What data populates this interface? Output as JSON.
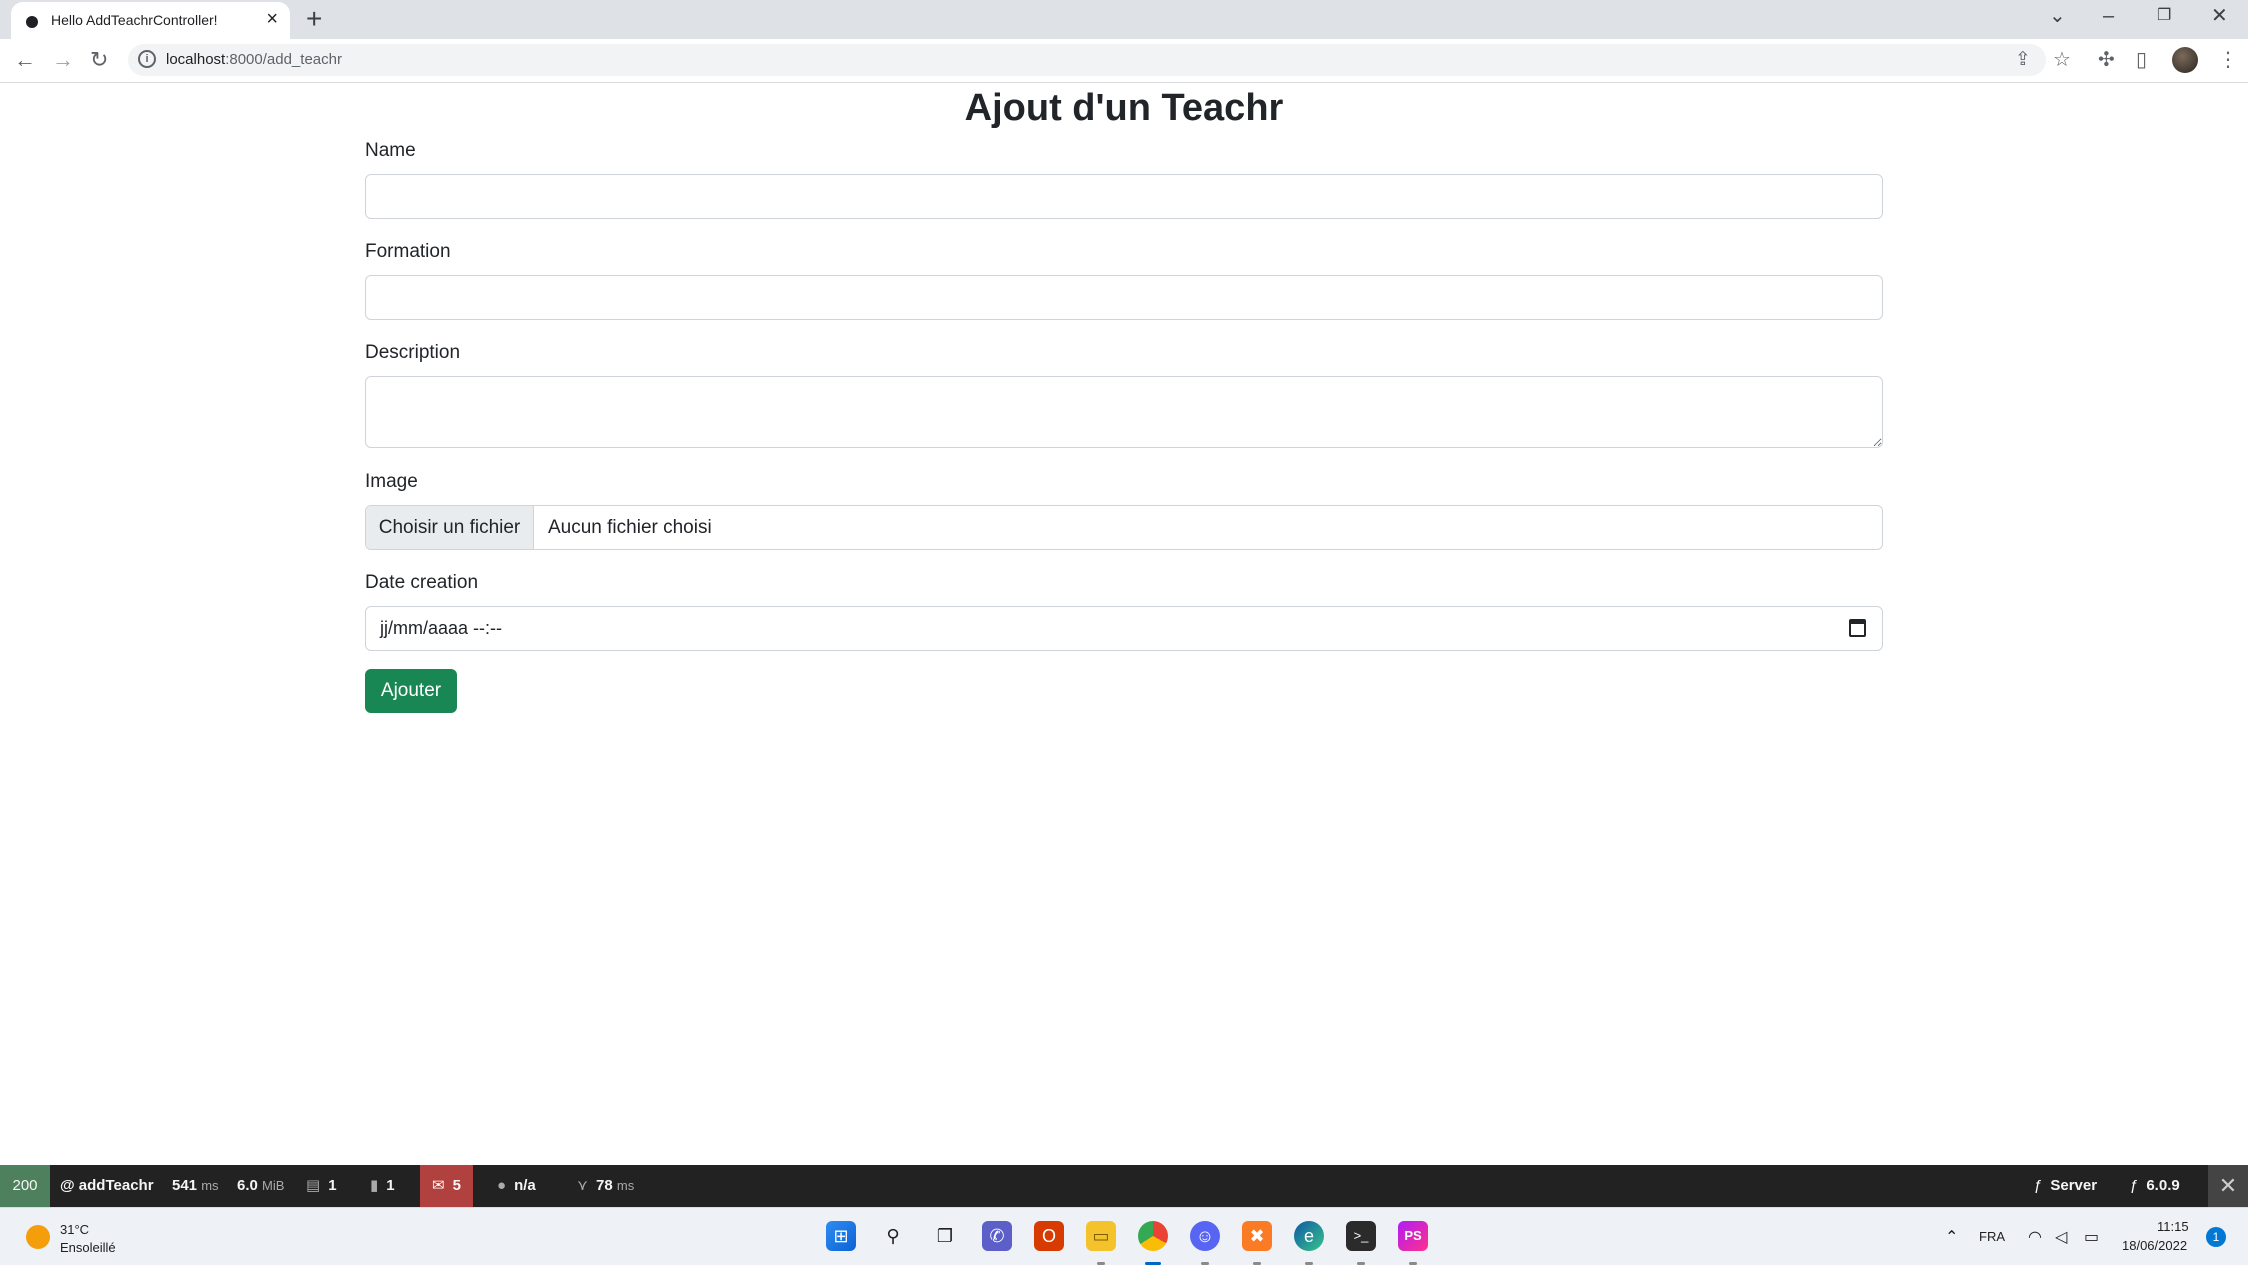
{
  "browser": {
    "tab_title": "Hello AddTeachrController!",
    "url_host": "localhost",
    "url_path": ":8000/add_teachr"
  },
  "page": {
    "title": "Ajout d'un Teachr",
    "form": {
      "name_label": "Name",
      "formation_label": "Formation",
      "description_label": "Description",
      "image_label": "Image",
      "file_button": "Choisir un fichier",
      "file_status": "Aucun fichier choisi",
      "date_label": "Date creation",
      "date_placeholder": "jj/mm/aaaa --:--",
      "submit_label": "Ajouter"
    }
  },
  "debug_toolbar": {
    "status_code": "200",
    "route": "@ addTeachr",
    "time_value": "541",
    "time_unit": "ms",
    "memory_value": "6.0",
    "memory_unit": "MiB",
    "forms_count": "1",
    "validator_count": "1",
    "logs_count": "5",
    "user": "n/a",
    "twig_value": "78",
    "twig_unit": "ms",
    "server_label": "Server",
    "symfony_version": "6.0.9"
  },
  "taskbar": {
    "weather_temp": "31°C",
    "weather_desc": "Ensoleillé",
    "language": "FRA",
    "time": "11:15",
    "date": "18/06/2022",
    "notifications": "1"
  },
  "colors": {
    "primary_button": "#198754",
    "status_ok": "#4f805d",
    "status_error": "#b0413e"
  }
}
